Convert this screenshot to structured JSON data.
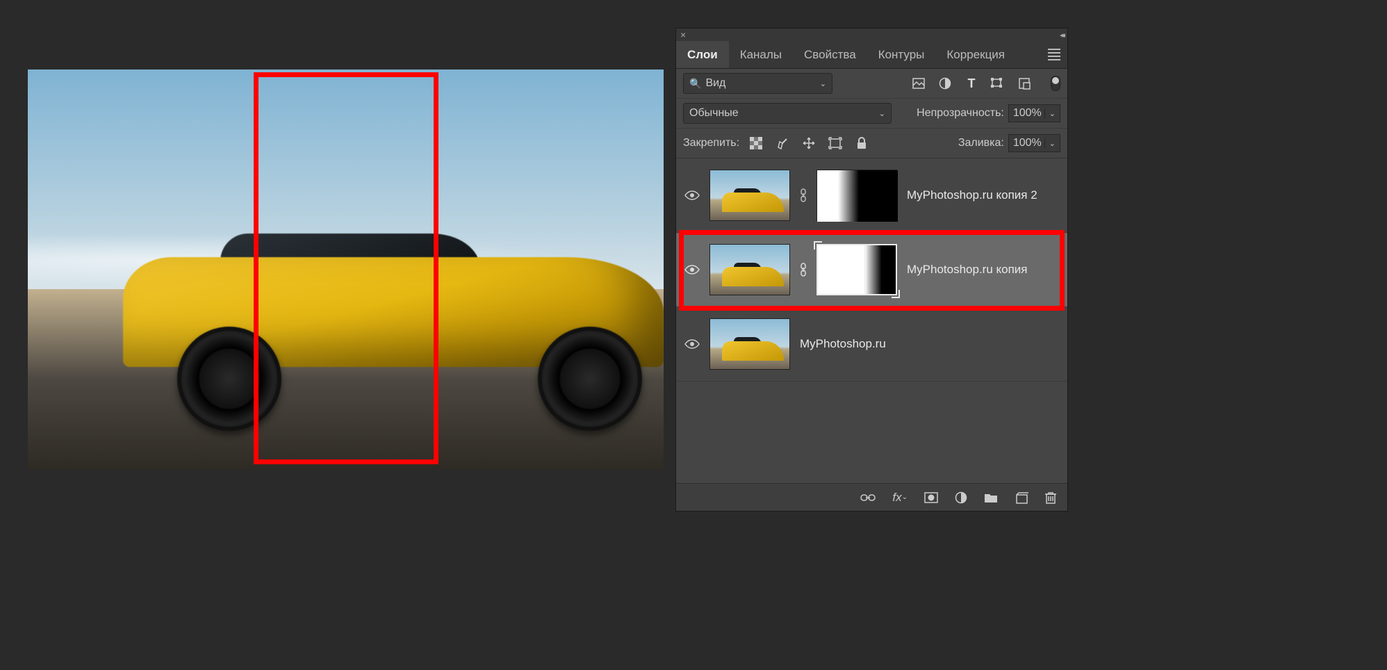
{
  "tabs": {
    "layers": "Слои",
    "channels": "Каналы",
    "properties": "Свойства",
    "paths": "Контуры",
    "adjustments": "Коррекция"
  },
  "search": {
    "label": "Вид"
  },
  "blend": {
    "mode": "Обычные",
    "opacity_label": "Непрозрачность:",
    "opacity_value": "100%"
  },
  "lock": {
    "label": "Закрепить:",
    "fill_label": "Заливка:",
    "fill_value": "100%"
  },
  "layers": [
    {
      "name": "MyPhotoshop.ru копия 2",
      "selected": false,
      "has_mask": true,
      "mask_type": 1,
      "highlighted": false
    },
    {
      "name": "MyPhotoshop.ru копия",
      "selected": true,
      "has_mask": true,
      "mask_type": 2,
      "highlighted": true
    },
    {
      "name": "MyPhotoshop.ru",
      "selected": false,
      "has_mask": false,
      "highlighted": false
    }
  ]
}
